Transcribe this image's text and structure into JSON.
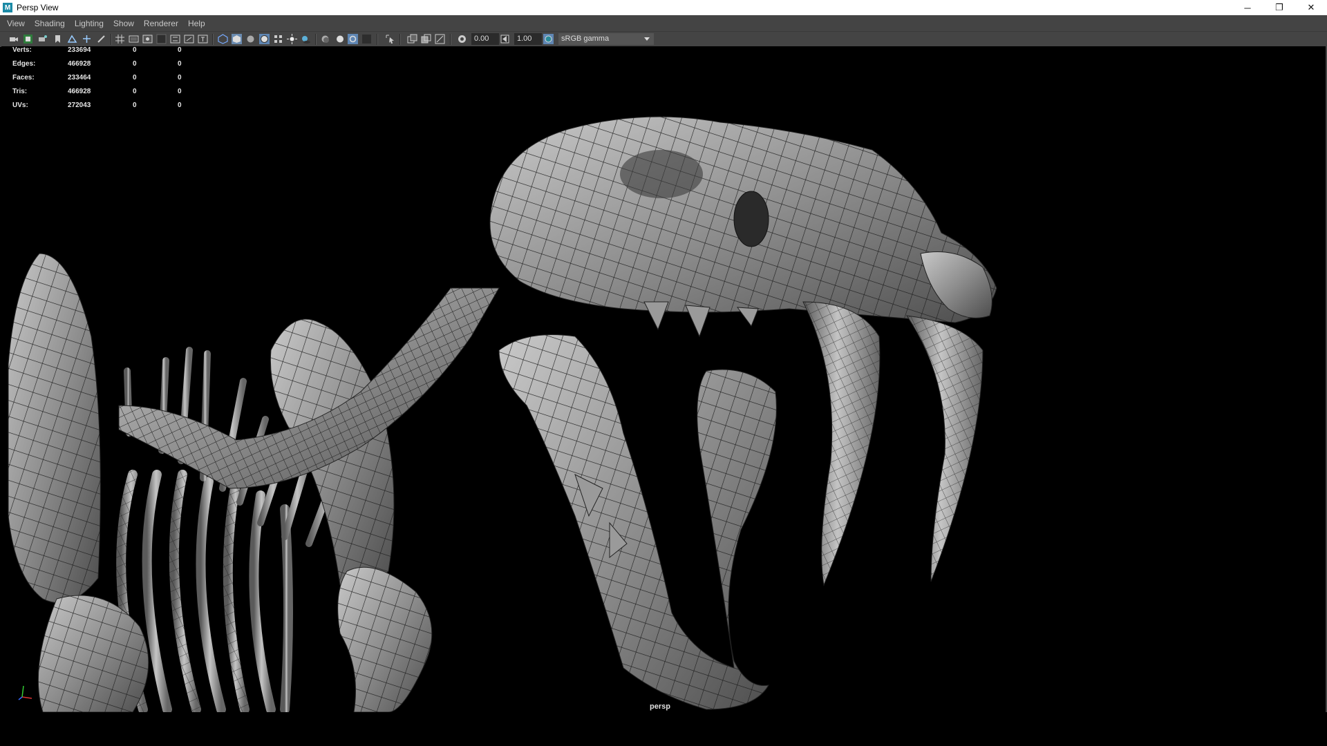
{
  "window": {
    "title": "Persp View",
    "app_icon": "M",
    "controls": {
      "minimize": "─",
      "restore": "❐",
      "close": "✕"
    }
  },
  "menu": [
    "View",
    "Shading",
    "Lighting",
    "Show",
    "Renderer",
    "Help"
  ],
  "toolbar": {
    "exposure": "0.00",
    "gamma": "1.00",
    "color_space": "sRGB gamma"
  },
  "hud": [
    {
      "label": "Verts:",
      "total": "233694",
      "selected": "0",
      "components": "0"
    },
    {
      "label": "Edges:",
      "total": "466928",
      "selected": "0",
      "components": "0"
    },
    {
      "label": "Faces:",
      "total": "233464",
      "selected": "0",
      "components": "0"
    },
    {
      "label": "Tris:",
      "total": "466928",
      "selected": "0",
      "components": "0"
    },
    {
      "label": "UVs:",
      "total": "272043",
      "selected": "0",
      "components": "0"
    }
  ],
  "camera_label": "persp",
  "colors": {
    "bg": "#000000",
    "panel": "#444444",
    "mesh": "#8f8f8f",
    "wire": "#1a1a1a"
  }
}
